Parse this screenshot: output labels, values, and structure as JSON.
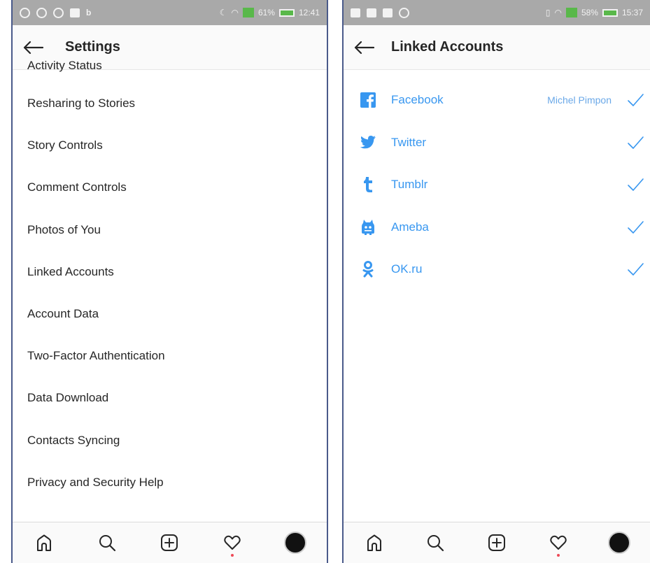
{
  "left": {
    "status_bar": {
      "battery": "61%",
      "time": "12:41"
    },
    "header": {
      "title": "Settings"
    },
    "items": [
      {
        "label": "Activity Status"
      },
      {
        "label": "Resharing to Stories"
      },
      {
        "label": "Story Controls"
      },
      {
        "label": "Comment Controls"
      },
      {
        "label": "Photos of You"
      },
      {
        "label": "Linked Accounts"
      },
      {
        "label": "Account Data"
      },
      {
        "label": "Two-Factor Authentication"
      },
      {
        "label": "Data Download"
      },
      {
        "label": "Contacts Syncing"
      },
      {
        "label": "Privacy and Security Help"
      }
    ]
  },
  "right": {
    "status_bar": {
      "battery": "58%",
      "time": "15:37"
    },
    "header": {
      "title": "Linked Accounts"
    },
    "accounts": [
      {
        "name": "Facebook",
        "user": "Michel Pimpon",
        "icon": "facebook-icon",
        "linked": true
      },
      {
        "name": "Twitter",
        "user": "",
        "icon": "twitter-icon",
        "linked": true
      },
      {
        "name": "Tumblr",
        "user": "",
        "icon": "tumblr-icon",
        "linked": true
      },
      {
        "name": "Ameba",
        "user": "",
        "icon": "ameba-icon",
        "linked": true
      },
      {
        "name": "OK.ru",
        "user": "",
        "icon": "okru-icon",
        "linked": true
      }
    ]
  },
  "colors": {
    "accent": "#3897f0",
    "status_bar": "#a9a9a9",
    "text": "#262626"
  },
  "tab_bar": [
    "home-icon",
    "search-icon",
    "add-icon",
    "heart-icon",
    "profile-avatar"
  ]
}
